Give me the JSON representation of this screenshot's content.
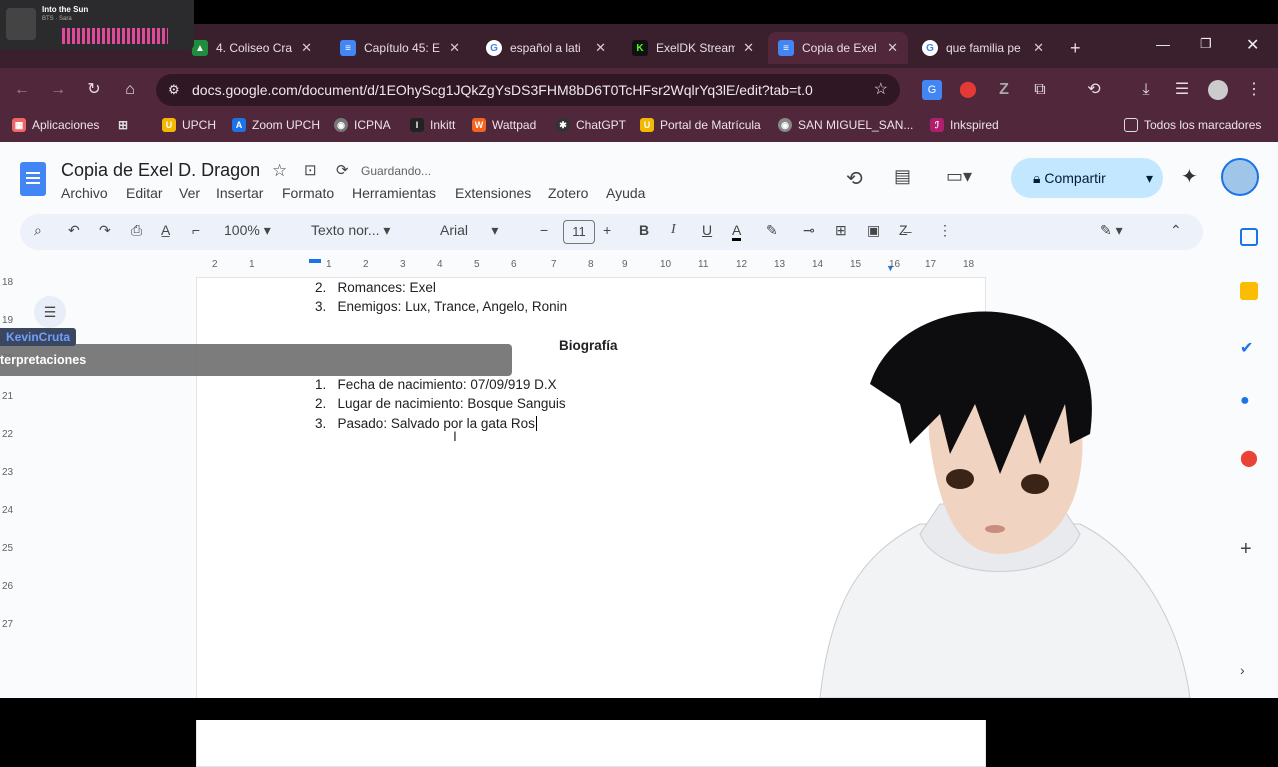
{
  "media": {
    "title": "Into the Sun",
    "artist": "BTS · Sara"
  },
  "tabs": [
    {
      "label": "4. Coliseo Cra",
      "icon": "google-drive-icon",
      "color": "#1e8e3e"
    },
    {
      "label": "Capítulo 45: E",
      "icon": "docs-icon",
      "color": "#4285f4"
    },
    {
      "label": "español a lati",
      "icon": "google-icon",
      "color": "#fff"
    },
    {
      "label": "ExelDK Stream",
      "icon": "kick-icon",
      "color": "#53fc18"
    },
    {
      "label": "Copia de Exel",
      "icon": "docs-icon",
      "color": "#4285f4"
    },
    {
      "label": "que familia pe",
      "icon": "google-icon",
      "color": "#fff"
    }
  ],
  "url": "docs.google.com/document/d/1EOhyScg1JQkZgYsDS3FHM8bD6T0TcHFsr2WqlrYq3lE/edit?tab=t.0",
  "bookmarks": [
    {
      "label": "Aplicaciones",
      "color": "#e66"
    },
    {
      "label": "",
      "color": "#aaa"
    },
    {
      "label": "UPCH",
      "color": "#f5b800"
    },
    {
      "label": "Zoom UPCH",
      "color": "#1a73e8"
    },
    {
      "label": "ICPNA",
      "color": "#777"
    },
    {
      "label": "Inkitt",
      "color": "#222"
    },
    {
      "label": "Wattpad",
      "color": "#f5641e"
    },
    {
      "label": "ChatGPT",
      "color": "#333"
    },
    {
      "label": "Portal de Matrícula",
      "color": "#f5b800"
    },
    {
      "label": "SAN MIGUEL_SAN...",
      "color": "#888"
    },
    {
      "label": "Inkspired",
      "color": "#b01e6e"
    },
    {
      "label": "Todos los marcadores",
      "color": "#000"
    }
  ],
  "doc": {
    "title": "Copia de Exel D. Dragon",
    "status": "Guardando...",
    "menus": [
      "Archivo",
      "Editar",
      "Ver",
      "Insertar",
      "Formato",
      "Herramientas",
      "Extensiones",
      "Zotero",
      "Ayuda"
    ],
    "share": "Compartir",
    "zoom": "100%",
    "style": "Texto nor...",
    "font": "Arial",
    "size": "11",
    "ruler": [
      "2",
      "1",
      "1",
      "2",
      "3",
      "4",
      "5",
      "6",
      "7",
      "8",
      "9",
      "10",
      "11",
      "12",
      "13",
      "14",
      "15",
      "16",
      "17",
      "18"
    ],
    "ruler_v": [
      "18",
      "19",
      "20",
      "21",
      "22",
      "23",
      "24",
      "25",
      "26",
      "27"
    ],
    "lines": [
      {
        "num": "2.",
        "text": "Romances: Exel"
      },
      {
        "num": "3.",
        "text": "Enemigos: Lux, Trance, Angelo, Ronin"
      },
      {
        "num": "",
        "text": "Biografía",
        "heading": true
      },
      {
        "num": "1.",
        "text": "Fecha de nacimiento: 07/09/919 D.X"
      },
      {
        "num": "2.",
        "text": "Lugar de nacimiento: Bosque Sanguis"
      },
      {
        "num": "3.",
        "text": "Pasado: Salvado por la gata Ros"
      }
    ]
  },
  "overlay": {
    "user": "KevinCruta",
    "text": "terpretaciones"
  },
  "colors": {
    "tabstrip": "#3a1f2c",
    "toolbar": "#51283b",
    "accent": "#0b57d0",
    "share_bg": "#c2e7ff"
  }
}
